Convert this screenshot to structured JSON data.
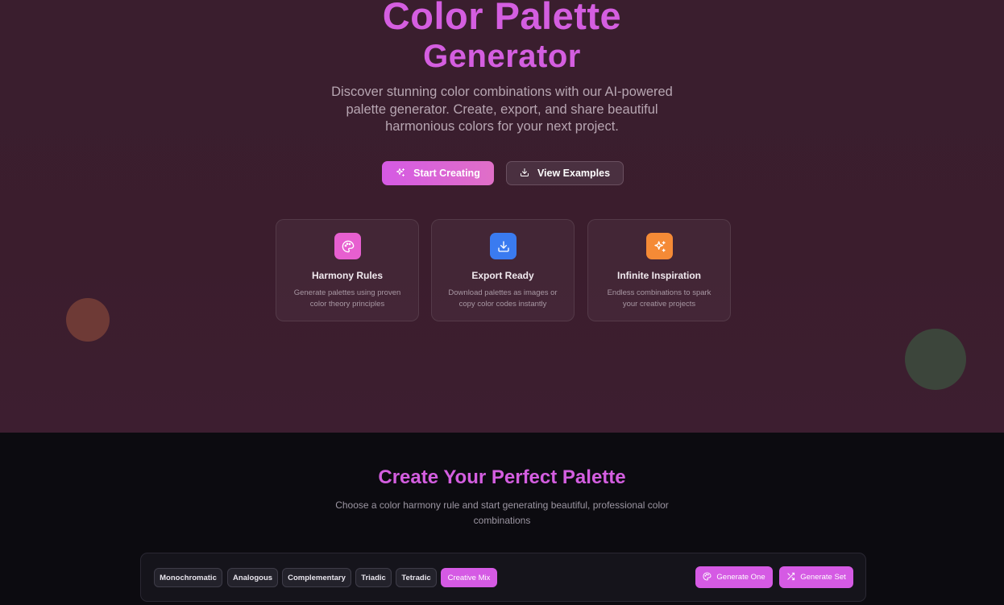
{
  "hero": {
    "title_line1": "Color Palette",
    "title_line2": "Generator",
    "description": "Discover stunning color combinations with our AI-powered palette generator. Create, export, and share beautiful harmonious colors for your next project.",
    "primary_button": {
      "label": "Start Creating",
      "icon": "sparkles-icon"
    },
    "secondary_button": {
      "label": "View Examples",
      "icon": "download-icon"
    },
    "features": [
      {
        "title": "Harmony Rules",
        "description": "Generate palettes using proven color theory principles",
        "icon": "palette-icon",
        "icon_color": "#e75fd0"
      },
      {
        "title": "Export Ready",
        "description": "Download palettes as images or copy color codes instantly",
        "icon": "download-icon",
        "icon_color": "#3a7bf0"
      },
      {
        "title": "Infinite Inspiration",
        "description": "Endless combinations to spark your creative projects",
        "icon": "sparkles-icon",
        "icon_color": "#f58a36"
      }
    ]
  },
  "generator": {
    "title": "Create Your Perfect Palette",
    "description": "Choose a color harmony rule and start generating beautiful, professional color combinations",
    "harmony_rules": [
      "Monochromatic",
      "Analogous",
      "Complementary",
      "Triadic",
      "Tetradic",
      "Creative Mix"
    ],
    "active_rule": "Creative Mix",
    "generate_one_label": "Generate One",
    "generate_set_label": "Generate Set"
  },
  "colors": {
    "accent": "#d55ae4",
    "hero_bg": "#3a1e2e",
    "page_bg": "#0c0b10"
  }
}
